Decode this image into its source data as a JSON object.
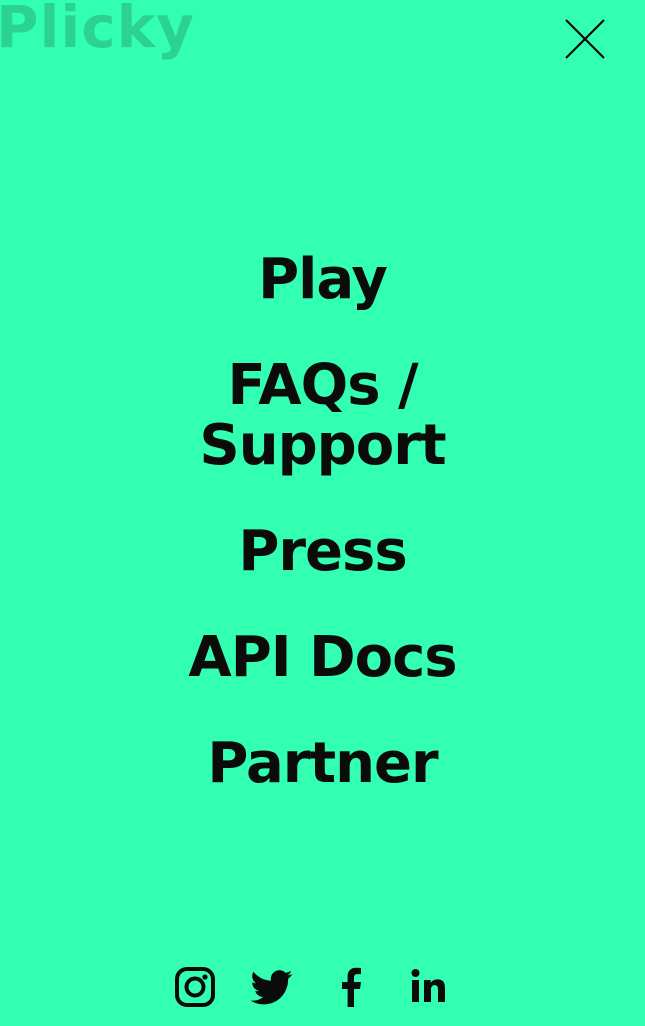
{
  "colors": {
    "background": "#33ffb3",
    "text": "#0b0b0b"
  },
  "header": {
    "logo_text": "Plicky",
    "close_icon": "close-icon"
  },
  "menu": {
    "items": [
      {
        "label": "Play"
      },
      {
        "label": "FAQs / Support"
      },
      {
        "label": "Press"
      },
      {
        "label": "API Docs"
      },
      {
        "label": "Partner"
      }
    ]
  },
  "social": {
    "icons": [
      "instagram-icon",
      "twitter-icon",
      "facebook-icon",
      "linkedin-icon"
    ]
  }
}
